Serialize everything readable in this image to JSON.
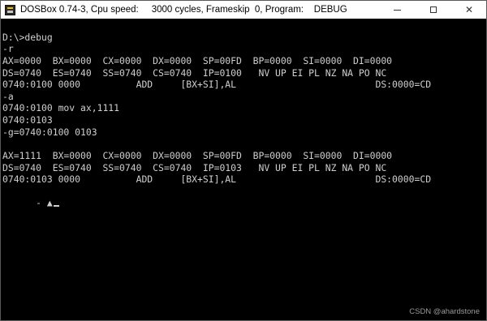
{
  "window": {
    "title": "DOSBox 0.74-3, Cpu speed:     3000 cycles, Frameskip  0, Program:    DEBUG",
    "minimize_glyph": "—",
    "maximize_glyph": "☐",
    "close_glyph": "✕"
  },
  "console": {
    "lines": [
      "D:\\>debug",
      "-r",
      "AX=0000  BX=0000  CX=0000  DX=0000  SP=00FD  BP=0000  SI=0000  DI=0000",
      "DS=0740  ES=0740  SS=0740  CS=0740  IP=0100   NV UP EI PL NZ NA PO NC",
      "0740:0100 0000          ADD     [BX+SI],AL                         DS:0000=CD",
      "-a",
      "0740:0100 mov ax,1111",
      "0740:0103",
      "-g=0740:0100 0103",
      "",
      "AX=1111  BX=0000  CX=0000  DX=0000  SP=00FD  BP=0000  SI=0000  DI=0000",
      "DS=0740  ES=0740  SS=0740  CS=0740  IP=0103   NV UP EI PL NZ NA PO NC",
      "0740:0103 0000          ADD     [BX+SI],AL                         DS:0000=CD",
      "- ▲"
    ]
  },
  "watermark": "CSDN @ahardstone",
  "colors": {
    "titlebar_bg": "#ffffff",
    "console_bg": "#000000",
    "console_text": "#cfcfcf"
  }
}
